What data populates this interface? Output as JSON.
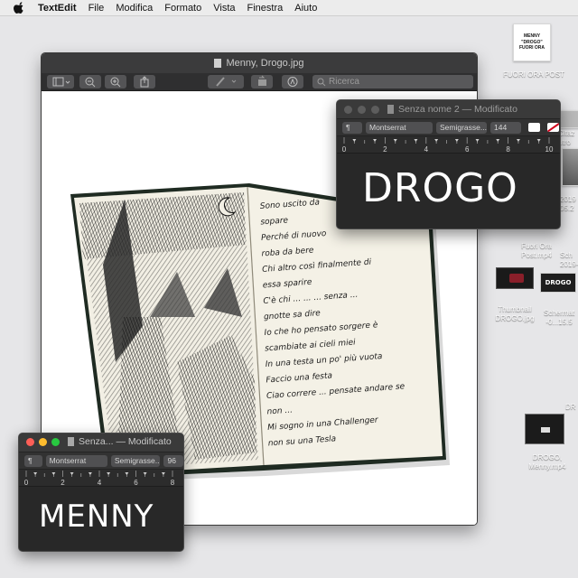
{
  "menubar": {
    "items": [
      "TextEdit",
      "File",
      "Modifica",
      "Formato",
      "Vista",
      "Finestra",
      "Aiuto"
    ]
  },
  "desktop": {
    "fuori_ora_post": {
      "thumb_text": "MENNY\n\"DROGO\"\nFUORI ORA",
      "label": "FUORI ORA POST"
    },
    "citaz": {
      "label_l1": "Citaz",
      "label_l2": "ntro"
    },
    "screenshot_2019_top": {
      "label_l1": "2019",
      "label_l2": "05.2"
    },
    "fuori_ora_mp4": {
      "label_l1": "Fuori Ora",
      "label_l2": "Post.mp4"
    },
    "schermata_top": {
      "label_l1": "Sch",
      "label_l2": "2019-0"
    },
    "thumbnail_drogo": {
      "label_l1": "Thumbnail",
      "label_l2": "DROGO.jpg"
    },
    "schermata_mid": {
      "label_l1": "Schermat",
      "label_l2": "-0...15.5",
      "thumb_text": "DROGO"
    },
    "drogo_menny_mp4": {
      "label_l1": "DROGO,",
      "label_l2": "Menny.mp4"
    },
    "edge_label": "DR"
  },
  "preview": {
    "title": "Menny, Drogo.jpg",
    "search_placeholder": "Ricerca"
  },
  "textedit_drogo": {
    "title": "Senza nome 2",
    "status": "— Modificato",
    "font": "Montserrat",
    "weight": "Semigrasse...",
    "size": "144",
    "ruler_numbers": [
      "0",
      "2",
      "4",
      "6",
      "8",
      "10"
    ],
    "content": "DROGO"
  },
  "textedit_menny": {
    "title": "Senza...",
    "status": "— Modificato",
    "font": "Montserrat",
    "weight": "Semigrasse...",
    "size": "96",
    "ruler_numbers": [
      "0",
      "2",
      "4",
      "6",
      "8"
    ],
    "content": "MENNY"
  },
  "sketchbook": {
    "lines": [
      "Sono uscito da",
      "sopare",
      "Perché di nuovo",
      "roba da bere",
      "Chi altro così finalmente di",
      "essa sparire",
      "C'è chi ... ... ... senza ...",
      "gnotte sa dire",
      "Io che ho pensato sorgere è",
      "scambiate ai cieli miei",
      "In una testa un po' più vuota",
      "Faccio una festa",
      "Ciao correre ... pensate andare se",
      "non ... ",
      "Mi sogno in una Challenger",
      "non su una Tesla"
    ]
  }
}
